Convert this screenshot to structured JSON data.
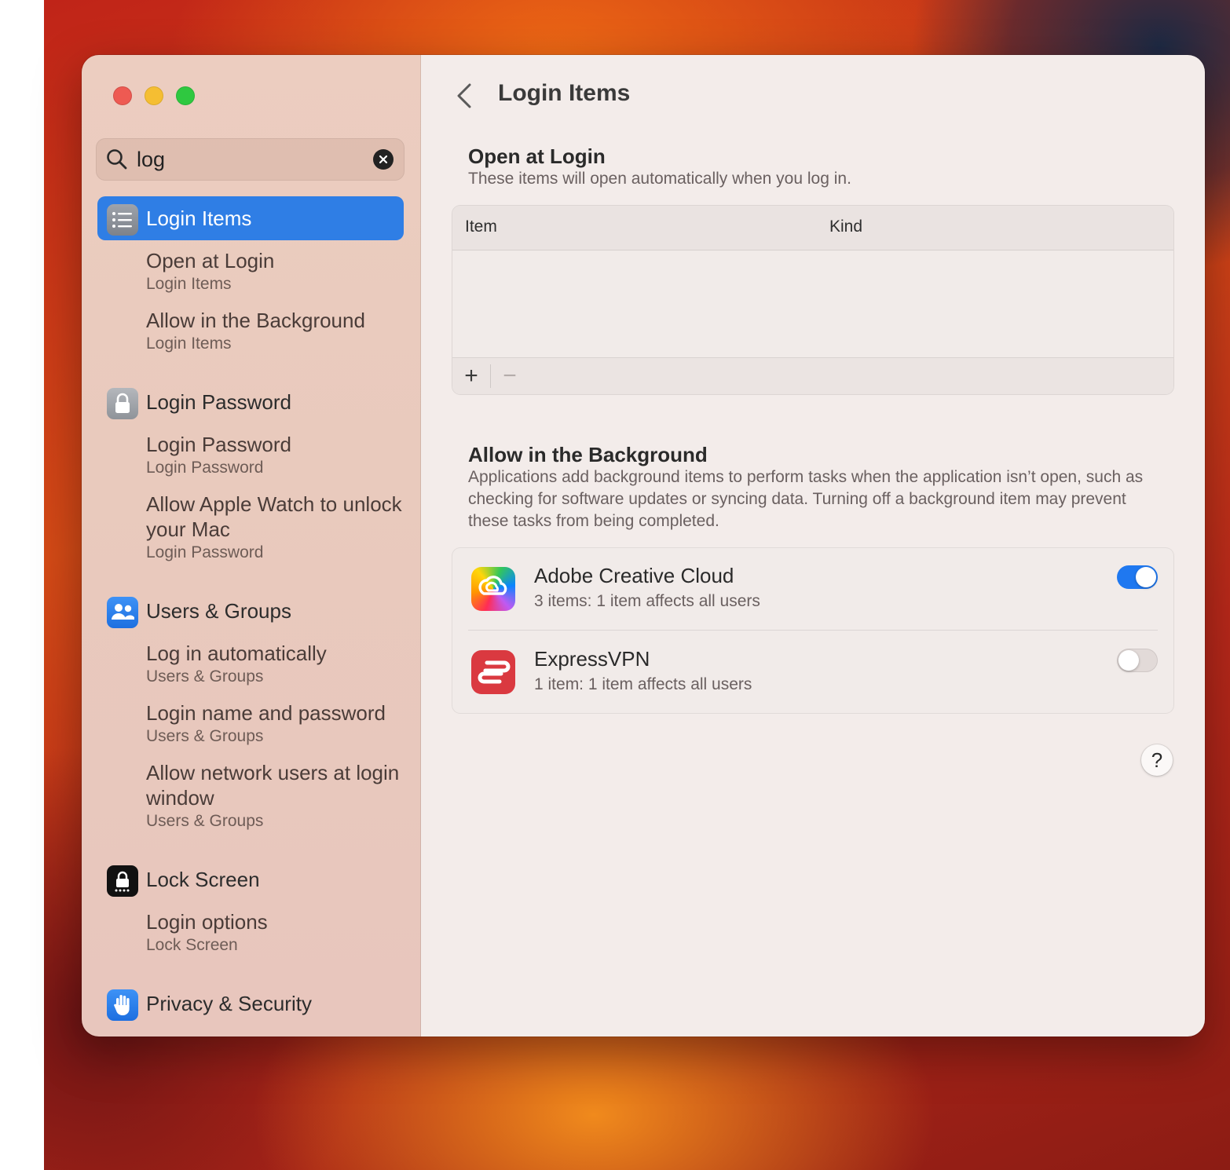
{
  "window": {
    "title": "Login Items"
  },
  "search": {
    "value": "log",
    "icon": "magnifying-glass-icon",
    "clear_icon": "clear-x-icon"
  },
  "sidebar": {
    "results": [
      {
        "label": "Login Items",
        "icon": "list-icon",
        "selected": true,
        "subs": [
          {
            "title": "Open at Login",
            "category": "Login Items"
          },
          {
            "title": "Allow in the Background",
            "category": "Login Items"
          }
        ]
      },
      {
        "label": "Login Password",
        "icon": "lock-icon",
        "selected": false,
        "subs": [
          {
            "title": "Login Password",
            "category": "Login Password"
          },
          {
            "title": "Allow Apple Watch to unlock your Mac",
            "category": "Login Password"
          }
        ]
      },
      {
        "label": "Users & Groups",
        "icon": "users-icon",
        "selected": false,
        "subs": [
          {
            "title": "Log in automatically",
            "category": "Users & Groups"
          },
          {
            "title": "Login name and password",
            "category": "Users & Groups"
          },
          {
            "title": "Allow network users at login window",
            "category": "Users & Groups"
          }
        ]
      },
      {
        "label": "Lock Screen",
        "icon": "lock-screen-icon",
        "selected": false,
        "subs": [
          {
            "title": "Login options",
            "category": "Lock Screen"
          }
        ]
      },
      {
        "label": "Privacy & Security",
        "icon": "hand-icon",
        "selected": false,
        "subs": []
      }
    ]
  },
  "main": {
    "page_title": "Login Items",
    "open_at_login": {
      "title": "Open at Login",
      "description": "These items will open automatically when you log in.",
      "columns": [
        "Item",
        "Kind"
      ],
      "rows": [],
      "add_label": "+",
      "remove_label": "−"
    },
    "background": {
      "title": "Allow in the Background",
      "description": "Applications add background items to perform tasks when the application isn’t open, such as checking for software updates or syncing data. Turning off a background item may prevent these tasks from being completed.",
      "items": [
        {
          "name": "Adobe Creative Cloud",
          "detail": "3 items: 1 item affects all users",
          "enabled": true,
          "icon": "adobe-creative-cloud-icon"
        },
        {
          "name": "ExpressVPN",
          "detail": "1 item: 1 item affects all users",
          "enabled": false,
          "icon": "expressvpn-icon"
        }
      ]
    },
    "help_label": "?"
  },
  "colors": {
    "accent": "#2f7ee5",
    "toggle_on": "#1f78f0"
  }
}
